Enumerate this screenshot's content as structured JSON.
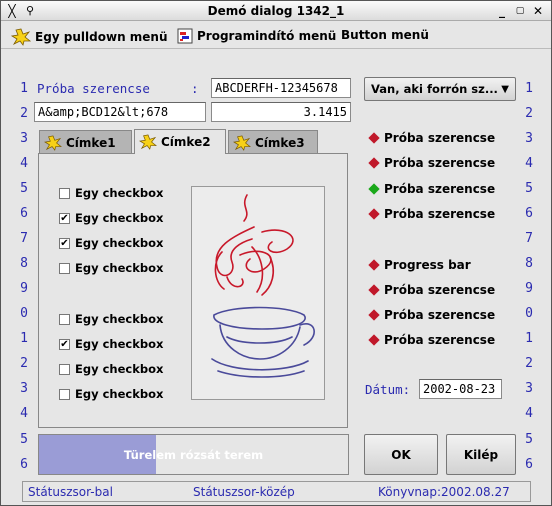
{
  "window": {
    "title": "Demó dialog 1342_1"
  },
  "colors": {
    "row_number": "#2b2bb0",
    "label": "#2b2bb0",
    "progress_fill": "#9a9cd6",
    "diamond_red": "#c0182a",
    "diamond_green": "#1aa81a"
  },
  "menubar": {
    "items": [
      {
        "label": "Egy pulldown menü",
        "icon": "burst-icon"
      },
      {
        "label": "Programindító menü",
        "icon": "app-icon"
      },
      {
        "label": "Button menü"
      }
    ]
  },
  "row_numbers_left": [
    "1",
    "2",
    "3",
    "4",
    "5",
    "6",
    "7",
    "8",
    "9",
    "0",
    "1",
    "2",
    "3",
    "4",
    "5",
    "6"
  ],
  "row_numbers_right": [
    "1",
    "2",
    "3",
    "4",
    "5",
    "6",
    "7",
    "8",
    "9",
    "0",
    "1",
    "2",
    "3",
    "4",
    "5",
    "6"
  ],
  "form": {
    "label1": "Próba szerencse",
    "colon": ":",
    "field1": "ABCDERFH-12345678",
    "field2": "A&amp;BCD12&lt;678",
    "field3": "3.1415",
    "combo": "Van, aki forrón sz..."
  },
  "tabs": [
    {
      "label": "Címke1"
    },
    {
      "label": "Címke2"
    },
    {
      "label": "Címke3"
    }
  ],
  "checkboxes": [
    {
      "label": "Egy checkbox",
      "checked": false
    },
    {
      "label": "Egy checkbox",
      "checked": true
    },
    {
      "label": "Egy checkbox",
      "checked": true
    },
    {
      "label": "Egy checkbox",
      "checked": false
    },
    {
      "label": "Egy checkbox",
      "checked": false
    },
    {
      "label": "Egy checkbox",
      "checked": true
    },
    {
      "label": "Egy checkbox",
      "checked": false
    },
    {
      "label": "Egy checkbox",
      "checked": false
    }
  ],
  "right_items": [
    {
      "label": "Próba szerencse",
      "color": "red"
    },
    {
      "label": "Próba szerencse",
      "color": "red"
    },
    {
      "label": "Próba szerencse",
      "color": "green"
    },
    {
      "label": "Próba szerencse",
      "color": "red"
    },
    {
      "label": "Progress bar",
      "color": "red"
    },
    {
      "label": "Próba szerencse",
      "color": "red"
    },
    {
      "label": "Próba szerencse",
      "color": "red"
    },
    {
      "label": "Próba szerencse",
      "color": "red"
    }
  ],
  "date": {
    "label": "Dátum:",
    "value": "2002-08-23"
  },
  "progress": {
    "text": "Türelem rózsát terem",
    "fraction": 0.38
  },
  "buttons": {
    "ok": "OK",
    "exit": "Kilép"
  },
  "statusbar": {
    "left": "Státuszsor-bal",
    "middle": "Státuszsor-közép",
    "right": "Könyvnap:2002.08.27"
  }
}
